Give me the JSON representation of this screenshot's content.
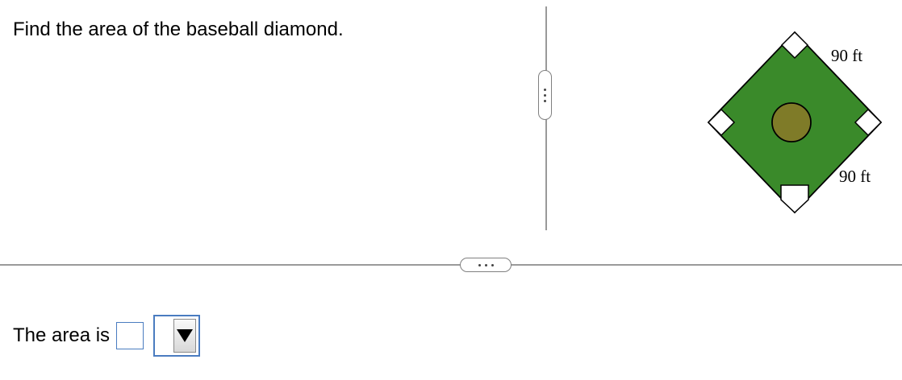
{
  "question": {
    "text": "Find the area of the baseball diamond."
  },
  "figure": {
    "side_label_top": "90 ft",
    "side_label_bottom": "90 ft",
    "colors": {
      "field": "#3a8a2a",
      "mound": "#7f7b28",
      "base": "#ffffff",
      "outline": "#000000"
    }
  },
  "answer": {
    "label": "The area is",
    "value": "",
    "unit_selected": ""
  },
  "icons": {
    "vertical_resize_handle": "vertical-ellipsis",
    "horizontal_resize_handle": "horizontal-ellipsis",
    "dropdown": "triangle-down"
  }
}
